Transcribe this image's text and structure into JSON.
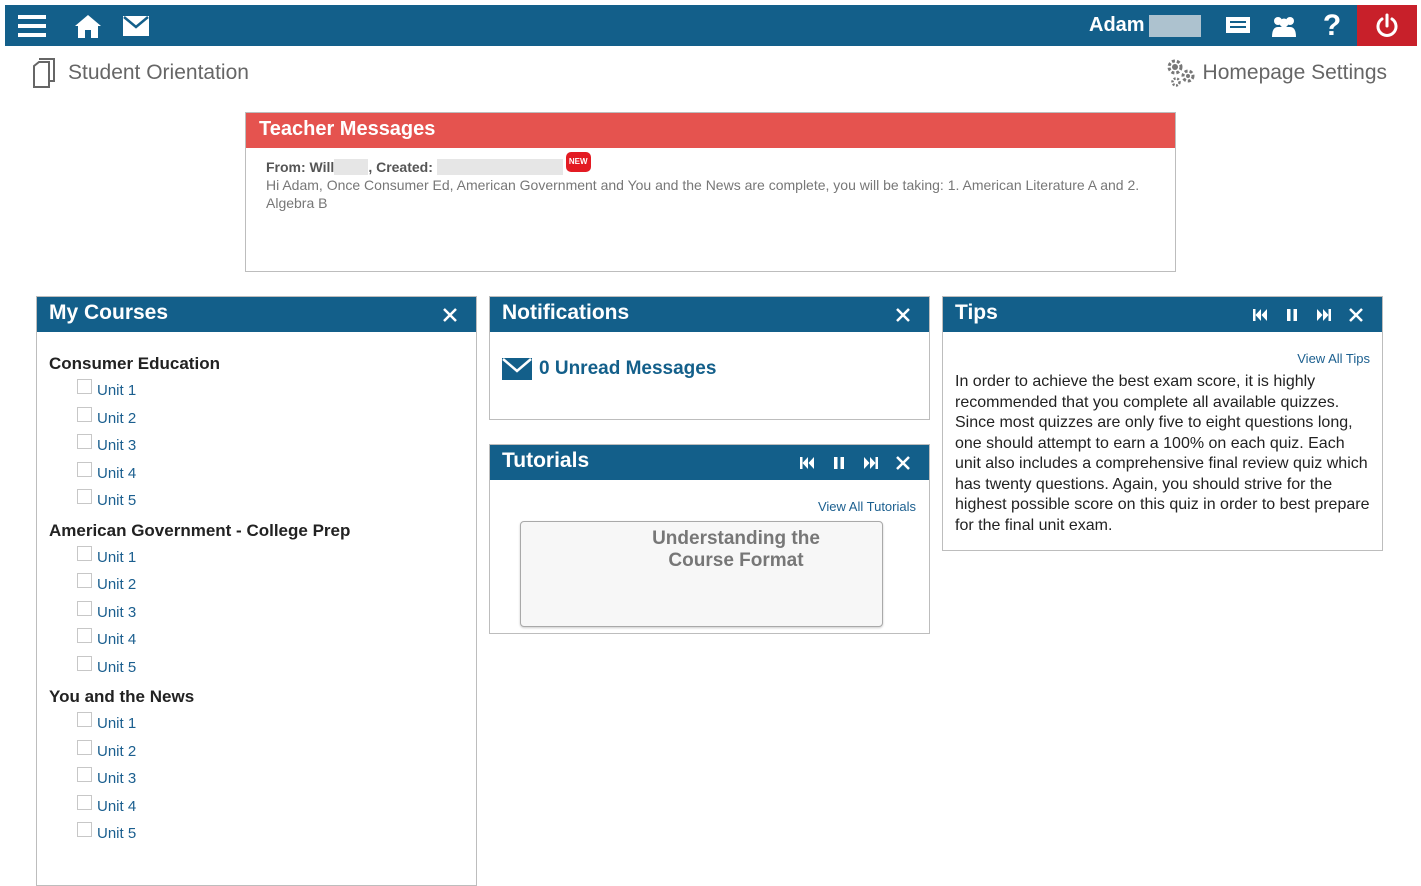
{
  "topbar": {
    "user_name": "Adam",
    "bg_color": "#135f8a",
    "power_color": "#c8202a",
    "icons": [
      "hamburger-menu-icon",
      "home-icon",
      "mail-icon",
      "chat-icon",
      "group-icon",
      "help-icon",
      "power-icon"
    ]
  },
  "breadcrumb": {
    "title": "Student Orientation"
  },
  "settings": {
    "label": "Homepage Settings"
  },
  "teacher_messages": {
    "title": "Teacher Messages",
    "header_color": "#e5534f",
    "from_label": "From: Will",
    "created_label": ", Created:",
    "new_badge": "NEW",
    "body": "Hi Adam, Once Consumer Ed, American Government and You and the News are complete, you will be taking: 1. American Literature A and 2. Algebra B"
  },
  "my_courses": {
    "title": "My Courses",
    "courses": [
      {
        "name": "Consumer Education",
        "units": [
          "Unit 1",
          "Unit 2",
          "Unit 3",
          "Unit 4",
          "Unit 5"
        ]
      },
      {
        "name": "American Government - College Prep",
        "units": [
          "Unit 1",
          "Unit 2",
          "Unit 3",
          "Unit 4",
          "Unit 5"
        ]
      },
      {
        "name": "You and the News",
        "units": [
          "Unit 1",
          "Unit 2",
          "Unit 3",
          "Unit 4",
          "Unit 5"
        ]
      }
    ]
  },
  "notifications": {
    "title": "Notifications",
    "unread_label": "0 Unread Messages"
  },
  "tutorials": {
    "title": "Tutorials",
    "view_all": "View All Tutorials",
    "card_title": "Understanding the Course Format"
  },
  "tips": {
    "title": "Tips",
    "view_all": "View All Tips",
    "body": "In order to achieve the best exam score, it is highly recommended that you complete all available quizzes. Since most quizzes are only five to eight questions long, one should attempt to earn a 100% on each quiz. Each unit also includes a comprehensive final review quiz which has twenty questions. Again, you should strive for the highest possible score on this quiz in order to best prepare for the final unit exam."
  }
}
